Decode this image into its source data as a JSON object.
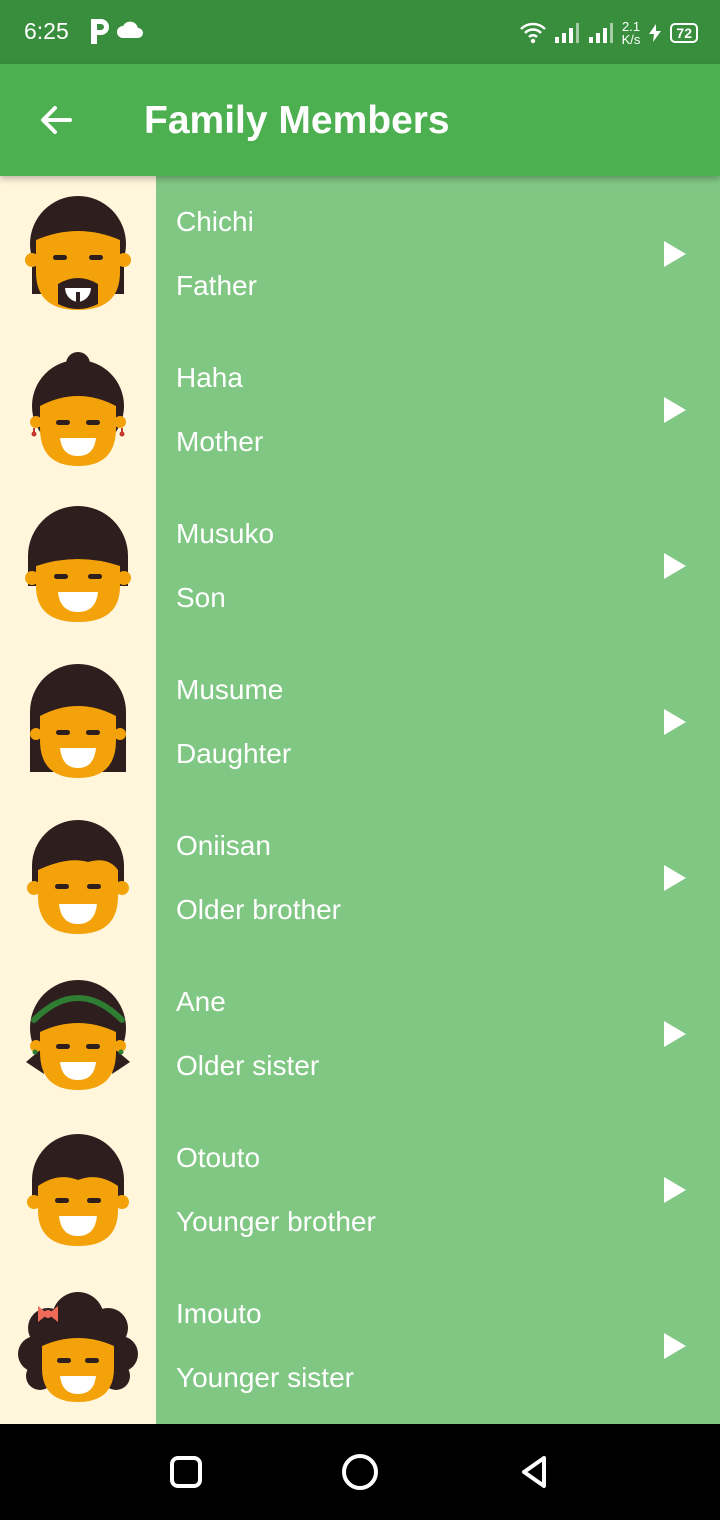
{
  "status_bar": {
    "time": "6:25",
    "net_speed_value": "2.1",
    "net_speed_unit": "K/s",
    "battery": "72",
    "icons": [
      "parking-icon",
      "cloud-icon",
      "wifi-icon",
      "signal-icon",
      "signal-icon",
      "charging-icon",
      "battery-icon"
    ]
  },
  "app_bar": {
    "title": "Family Members",
    "back_icon": "arrow-left-icon"
  },
  "colors": {
    "status_bar": "#388E3C",
    "app_bar": "#4CAF50",
    "list_background": "#81C784",
    "avatar_background": "#FFF6DC",
    "skin": "#F4A20A",
    "hair": "#2E1E1E"
  },
  "members": [
    {
      "name": "Chichi",
      "relation": "Father",
      "avatar": "father-avatar-icon"
    },
    {
      "name": "Haha",
      "relation": "Mother",
      "avatar": "mother-avatar-icon"
    },
    {
      "name": "Musuko",
      "relation": "Son",
      "avatar": "son-avatar-icon"
    },
    {
      "name": "Musume",
      "relation": "Daughter",
      "avatar": "daughter-avatar-icon"
    },
    {
      "name": "Oniisan",
      "relation": "Older brother",
      "avatar": "older-brother-avatar-icon"
    },
    {
      "name": "Ane",
      "relation": "Older sister",
      "avatar": "older-sister-avatar-icon"
    },
    {
      "name": "Otouto",
      "relation": "Younger brother",
      "avatar": "younger-brother-avatar-icon"
    },
    {
      "name": "Imouto",
      "relation": "Younger sister",
      "avatar": "younger-sister-avatar-icon"
    }
  ],
  "nav_bar": {
    "buttons": [
      "recents-square-icon",
      "home-circle-icon",
      "back-triangle-icon"
    ]
  }
}
